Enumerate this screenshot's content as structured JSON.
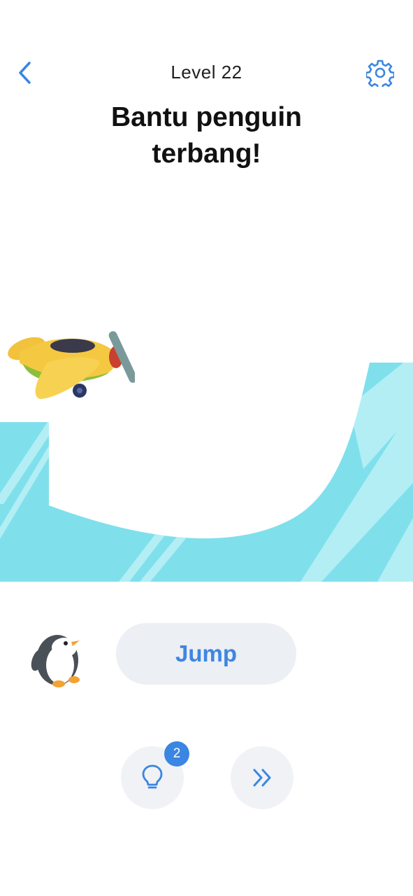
{
  "header": {
    "level_label": "Level 22",
    "back_icon": "chevron-left-icon",
    "settings_icon": "gear-icon"
  },
  "instruction": {
    "line1": "Bantu penguin",
    "line2": "terbang!"
  },
  "scene": {
    "water_color": "#7fe0ec",
    "water_light_color": "#b3eef5",
    "airplane": "airplane-sprite",
    "character": "penguin-sprite"
  },
  "controls": {
    "jump_label": "Jump",
    "hint_icon": "lightbulb-icon",
    "hint_count": "2",
    "skip_icon": "double-chevron-right-icon"
  },
  "colors": {
    "accent": "#3a86e2",
    "button_bg": "#eceff4"
  }
}
